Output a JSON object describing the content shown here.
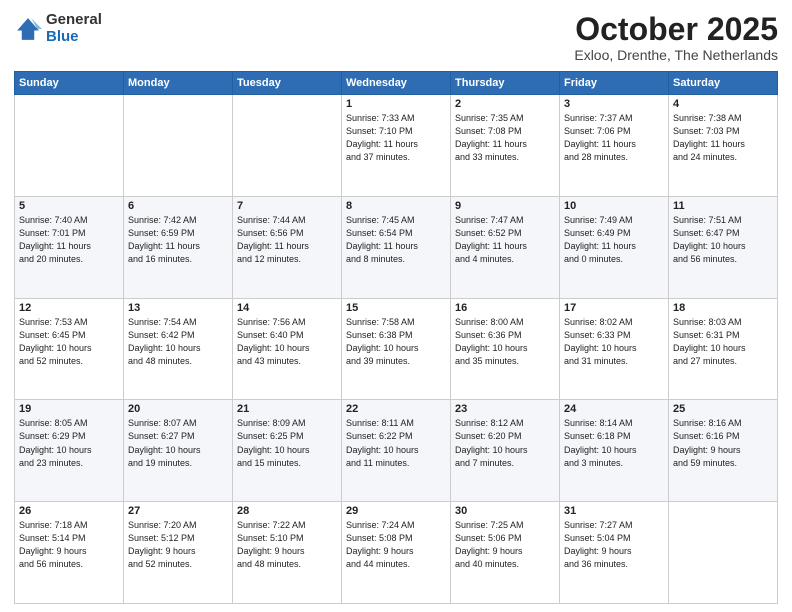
{
  "header": {
    "logo_general": "General",
    "logo_blue": "Blue",
    "title": "October 2025",
    "location": "Exloo, Drenthe, The Netherlands"
  },
  "days_of_week": [
    "Sunday",
    "Monday",
    "Tuesday",
    "Wednesday",
    "Thursday",
    "Friday",
    "Saturday"
  ],
  "weeks": [
    {
      "cells": [
        {
          "day": "",
          "info": ""
        },
        {
          "day": "",
          "info": ""
        },
        {
          "day": "",
          "info": ""
        },
        {
          "day": "1",
          "info": "Sunrise: 7:33 AM\nSunset: 7:10 PM\nDaylight: 11 hours\nand 37 minutes."
        },
        {
          "day": "2",
          "info": "Sunrise: 7:35 AM\nSunset: 7:08 PM\nDaylight: 11 hours\nand 33 minutes."
        },
        {
          "day": "3",
          "info": "Sunrise: 7:37 AM\nSunset: 7:06 PM\nDaylight: 11 hours\nand 28 minutes."
        },
        {
          "day": "4",
          "info": "Sunrise: 7:38 AM\nSunset: 7:03 PM\nDaylight: 11 hours\nand 24 minutes."
        }
      ]
    },
    {
      "cells": [
        {
          "day": "5",
          "info": "Sunrise: 7:40 AM\nSunset: 7:01 PM\nDaylight: 11 hours\nand 20 minutes."
        },
        {
          "day": "6",
          "info": "Sunrise: 7:42 AM\nSunset: 6:59 PM\nDaylight: 11 hours\nand 16 minutes."
        },
        {
          "day": "7",
          "info": "Sunrise: 7:44 AM\nSunset: 6:56 PM\nDaylight: 11 hours\nand 12 minutes."
        },
        {
          "day": "8",
          "info": "Sunrise: 7:45 AM\nSunset: 6:54 PM\nDaylight: 11 hours\nand 8 minutes."
        },
        {
          "day": "9",
          "info": "Sunrise: 7:47 AM\nSunset: 6:52 PM\nDaylight: 11 hours\nand 4 minutes."
        },
        {
          "day": "10",
          "info": "Sunrise: 7:49 AM\nSunset: 6:49 PM\nDaylight: 11 hours\nand 0 minutes."
        },
        {
          "day": "11",
          "info": "Sunrise: 7:51 AM\nSunset: 6:47 PM\nDaylight: 10 hours\nand 56 minutes."
        }
      ]
    },
    {
      "cells": [
        {
          "day": "12",
          "info": "Sunrise: 7:53 AM\nSunset: 6:45 PM\nDaylight: 10 hours\nand 52 minutes."
        },
        {
          "day": "13",
          "info": "Sunrise: 7:54 AM\nSunset: 6:42 PM\nDaylight: 10 hours\nand 48 minutes."
        },
        {
          "day": "14",
          "info": "Sunrise: 7:56 AM\nSunset: 6:40 PM\nDaylight: 10 hours\nand 43 minutes."
        },
        {
          "day": "15",
          "info": "Sunrise: 7:58 AM\nSunset: 6:38 PM\nDaylight: 10 hours\nand 39 minutes."
        },
        {
          "day": "16",
          "info": "Sunrise: 8:00 AM\nSunset: 6:36 PM\nDaylight: 10 hours\nand 35 minutes."
        },
        {
          "day": "17",
          "info": "Sunrise: 8:02 AM\nSunset: 6:33 PM\nDaylight: 10 hours\nand 31 minutes."
        },
        {
          "day": "18",
          "info": "Sunrise: 8:03 AM\nSunset: 6:31 PM\nDaylight: 10 hours\nand 27 minutes."
        }
      ]
    },
    {
      "cells": [
        {
          "day": "19",
          "info": "Sunrise: 8:05 AM\nSunset: 6:29 PM\nDaylight: 10 hours\nand 23 minutes."
        },
        {
          "day": "20",
          "info": "Sunrise: 8:07 AM\nSunset: 6:27 PM\nDaylight: 10 hours\nand 19 minutes."
        },
        {
          "day": "21",
          "info": "Sunrise: 8:09 AM\nSunset: 6:25 PM\nDaylight: 10 hours\nand 15 minutes."
        },
        {
          "day": "22",
          "info": "Sunrise: 8:11 AM\nSunset: 6:22 PM\nDaylight: 10 hours\nand 11 minutes."
        },
        {
          "day": "23",
          "info": "Sunrise: 8:12 AM\nSunset: 6:20 PM\nDaylight: 10 hours\nand 7 minutes."
        },
        {
          "day": "24",
          "info": "Sunrise: 8:14 AM\nSunset: 6:18 PM\nDaylight: 10 hours\nand 3 minutes."
        },
        {
          "day": "25",
          "info": "Sunrise: 8:16 AM\nSunset: 6:16 PM\nDaylight: 9 hours\nand 59 minutes."
        }
      ]
    },
    {
      "cells": [
        {
          "day": "26",
          "info": "Sunrise: 7:18 AM\nSunset: 5:14 PM\nDaylight: 9 hours\nand 56 minutes."
        },
        {
          "day": "27",
          "info": "Sunrise: 7:20 AM\nSunset: 5:12 PM\nDaylight: 9 hours\nand 52 minutes."
        },
        {
          "day": "28",
          "info": "Sunrise: 7:22 AM\nSunset: 5:10 PM\nDaylight: 9 hours\nand 48 minutes."
        },
        {
          "day": "29",
          "info": "Sunrise: 7:24 AM\nSunset: 5:08 PM\nDaylight: 9 hours\nand 44 minutes."
        },
        {
          "day": "30",
          "info": "Sunrise: 7:25 AM\nSunset: 5:06 PM\nDaylight: 9 hours\nand 40 minutes."
        },
        {
          "day": "31",
          "info": "Sunrise: 7:27 AM\nSunset: 5:04 PM\nDaylight: 9 hours\nand 36 minutes."
        },
        {
          "day": "",
          "info": ""
        }
      ]
    }
  ]
}
